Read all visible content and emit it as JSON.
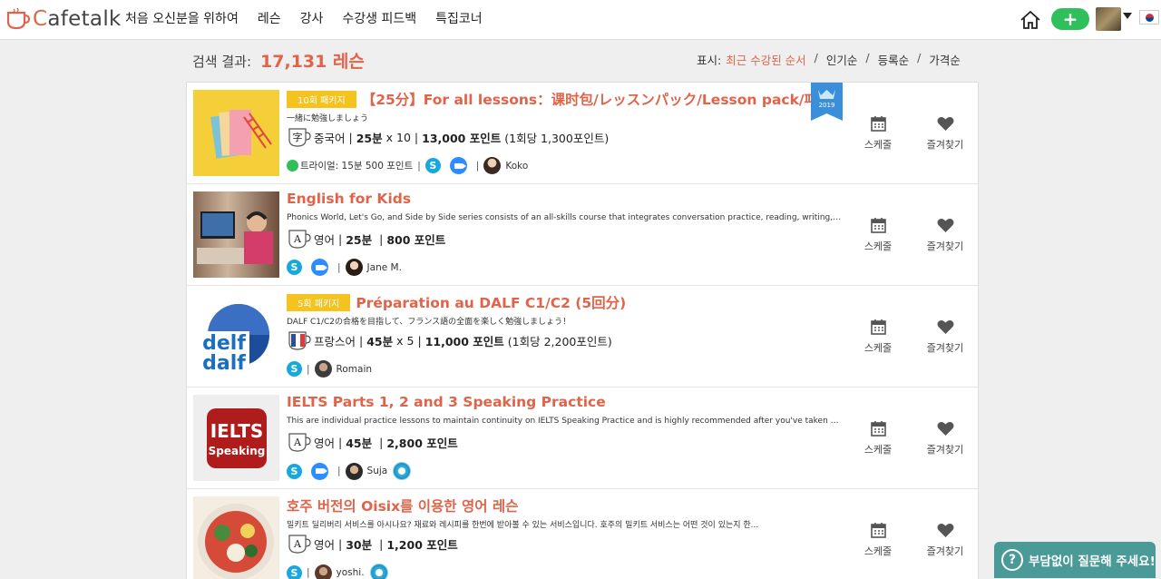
{
  "header": {
    "logo_text": "Cafetalk",
    "nav": [
      "처음 오신분을 위하여",
      "레슨",
      "강사",
      "수강생 피드백",
      "특집코너"
    ],
    "plus_label": "+"
  },
  "results": {
    "label": "검색 결과:",
    "count": "17,131 레슨"
  },
  "sort": {
    "label": "표시:",
    "options": [
      "최근 수강된 순서",
      "인기순",
      "등록순",
      "가격순"
    ],
    "active": "최근 수강된 순서",
    "separator": "/"
  },
  "actions": {
    "schedule": "스케줄",
    "favorite": "즐겨찾기"
  },
  "lessons": [
    {
      "package": "10회 패키지",
      "title": "【25分】For all lessons：课时包/レッスンパック/Lesson pack/패키지",
      "desc": "一緒に勉強しましょう",
      "lang": "중국어",
      "duration": "25분",
      "multiplier": "x 10",
      "price": "13,000 포인트",
      "per": "(1회당 1,300포인트)",
      "trial": "트라이얼: 15분 500 포인트",
      "tools": [
        "skype",
        "zoom"
      ],
      "tutor": "Koko",
      "ribbon": "2019"
    },
    {
      "package": "",
      "title": "English for Kids",
      "desc": "Phonics World, Let's Go, and Side by Side series consists of an all-skills course that integrates conversation practice, reading, writing, and...",
      "lang": "영어",
      "duration": "25분",
      "multiplier": "",
      "price": "800 포인트",
      "per": "",
      "trial": "",
      "tools": [
        "skype",
        "zoom"
      ],
      "tutor": "Jane M."
    },
    {
      "package": "5회 패키지",
      "title": "Préparation au DALF C1/C2 (5回分)",
      "desc": "DALF C1/C2の合格を目指して、フランス語の全面を楽しく勉強しましょう！",
      "lang": "프랑스어",
      "duration": "45분",
      "multiplier": "x 5",
      "price": "11,000 포인트",
      "per": "(1회당 2,200포인트)",
      "trial": "",
      "tools": [
        "skype"
      ],
      "tutor": "Romain",
      "thumb_text": [
        "delf",
        "dalf"
      ]
    },
    {
      "package": "",
      "title": "IELTS Parts 1, 2 and 3 Speaking Practice",
      "desc": "This are individual practice lessons to maintain continuity on IELTS Speaking Practice and is highly recommended after you've taken the I...",
      "lang": "영어",
      "duration": "45분",
      "multiplier": "",
      "price": "2,800 포인트",
      "per": "",
      "trial": "",
      "tools": [
        "skype",
        "zoom"
      ],
      "tutor": "Suja",
      "thumb_text": [
        "IELTS",
        "Speaking"
      ]
    },
    {
      "package": "",
      "title": "호주 버전의 Oisix를 이용한 영어 레슨",
      "desc": "밀키트 딜리버리 서비스를 아시나요? 재료와 레시피를 한번에 받아볼 수 있는 서비스입니다. 호주의 밀키트 서비스는 어떤 것이 있는지 한...",
      "lang": "영어",
      "duration": "30분",
      "multiplier": "",
      "price": "1,200 포인트",
      "per": "",
      "trial": "",
      "tools": [
        "skype"
      ],
      "tutor": "yoshi."
    }
  ],
  "chat": {
    "label": "부담없이 질문해 주세요!"
  },
  "icons": [
    "home-icon",
    "plus-icon",
    "caret-down-icon",
    "korea-flag-icon",
    "calendar-icon",
    "heart-icon",
    "skype-icon",
    "zoom-icon",
    "question-chat-icon"
  ],
  "colors": {
    "accent": "#e0644a",
    "package": "#f5c320",
    "green": "#2fbf5b",
    "chat": "#4a9a98"
  }
}
